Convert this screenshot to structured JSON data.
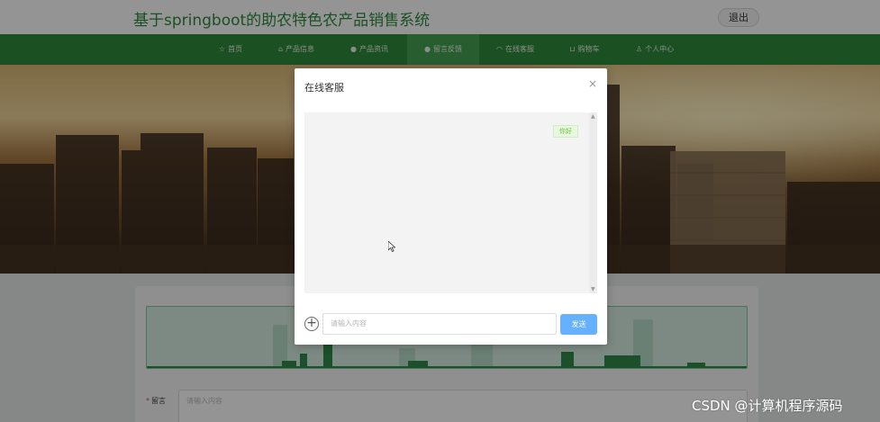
{
  "header": {
    "title": "基于springboot的助农特色农产品销售系统",
    "logout_label": "退出"
  },
  "nav": {
    "items": [
      {
        "icon": "star-icon",
        "glyph": "☆",
        "label": "首页"
      },
      {
        "icon": "home-icon",
        "glyph": "⌂",
        "label": "产品信息"
      },
      {
        "icon": "info-icon",
        "glyph": "●",
        "label": "产品资讯"
      },
      {
        "icon": "info-icon",
        "glyph": "●",
        "label": "留言反馈"
      },
      {
        "icon": "headset-icon",
        "glyph": "◠",
        "label": "在线客服"
      },
      {
        "icon": "cart-icon",
        "glyph": "⊔",
        "label": "购物车"
      },
      {
        "icon": "user-icon",
        "glyph": "♙",
        "label": "个人中心"
      }
    ],
    "active_index": 3
  },
  "form": {
    "message_label": "留言",
    "message_placeholder": "请输入内容"
  },
  "dialog": {
    "title": "在线客服",
    "close_glyph": "×",
    "bubble_text": "你好",
    "add_glyph": "+",
    "input_placeholder": "请输入内容",
    "send_label": "发送"
  },
  "watermark": "CSDN @计算机程序源码",
  "colors": {
    "brand_green": "#2f8a3b",
    "title_green": "#2e8b3e",
    "send_blue": "#66b1ff",
    "bubble_green": "#67c23a"
  }
}
